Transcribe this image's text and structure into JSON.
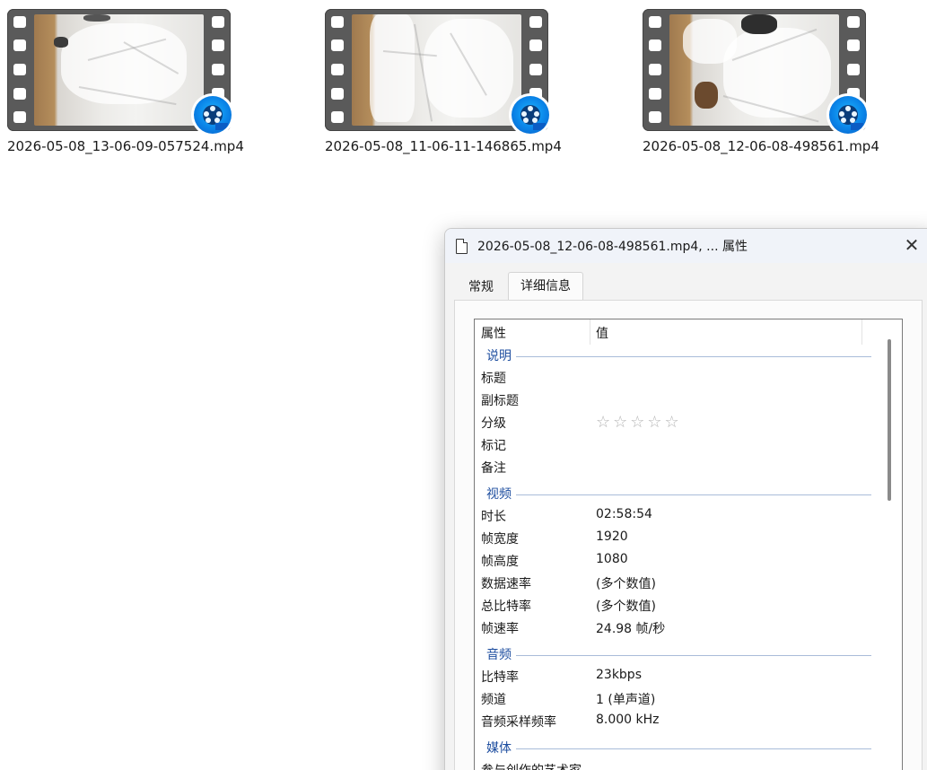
{
  "files": [
    {
      "name": "2026-05-08_13-06-09-057524.mp4",
      "badge_icon": "qqplayer-icon"
    },
    {
      "name": "2026-05-08_11-06-11-146865.mp4",
      "badge_icon": "qqplayer-icon"
    },
    {
      "name": "2026-05-08_12-06-08-498561.mp4",
      "badge_icon": "qqplayer-icon"
    }
  ],
  "dialog": {
    "title": "2026-05-08_12-06-08-498561.mp4, ... 属性",
    "close_label": "✕",
    "tabs": [
      {
        "label": "常规",
        "selected": false
      },
      {
        "label": "详细信息",
        "selected": true
      }
    ],
    "columns": {
      "property": "属性",
      "value": "值"
    },
    "groups": {
      "description": {
        "label": "说明",
        "rows": [
          {
            "key": "标题",
            "value": ""
          },
          {
            "key": "副标题",
            "value": ""
          },
          {
            "key": "分级",
            "value": "",
            "stars": "☆☆☆☆☆"
          },
          {
            "key": "标记",
            "value": ""
          },
          {
            "key": "备注",
            "value": ""
          }
        ]
      },
      "video": {
        "label": "视频",
        "rows": [
          {
            "key": "时长",
            "value": "02:58:54"
          },
          {
            "key": "帧宽度",
            "value": "1920"
          },
          {
            "key": "帧高度",
            "value": "1080"
          },
          {
            "key": "数据速率",
            "value": "(多个数值)"
          },
          {
            "key": "总比特率",
            "value": "(多个数值)"
          },
          {
            "key": "帧速率",
            "value": "24.98 帧/秒"
          }
        ]
      },
      "audio": {
        "label": "音频",
        "rows": [
          {
            "key": "比特率",
            "value": "23kbps"
          },
          {
            "key": "频道",
            "value": "1 (单声道)"
          },
          {
            "key": "音频采样频率",
            "value": "8.000 kHz"
          }
        ]
      },
      "media": {
        "label": "媒体",
        "rows": [
          {
            "key": "参与创作的艺术家",
            "value": ""
          }
        ]
      }
    }
  },
  "colors": {
    "group_label": "#1f4fa0",
    "badge_blue": "#0a84e8",
    "film_strip": "#5a5a5a"
  }
}
